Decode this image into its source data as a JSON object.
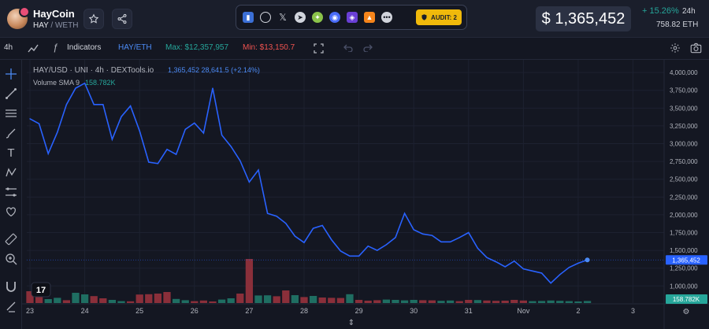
{
  "header": {
    "token_name": "HayCoin",
    "token_symbol": "HAY",
    "pair_quote": "/ WETH",
    "audit_label": "AUDIT: 2",
    "price": "$ 1,365,452",
    "change": "+ 15.26%",
    "change_period": "24h",
    "eth_price": "758.82 ETH",
    "positive_color": "#26a69a",
    "negative_color": "#ef5350",
    "line_color": "#2962ff"
  },
  "toolbar": {
    "timeframe": "4h",
    "indicators_label": "Indicators",
    "pair_label": "HAY/ETH",
    "max_label": "Max: $12,357,957",
    "min_label": "Min: $13,150.7"
  },
  "chart_data": {
    "type": "line",
    "legend_title": "HAY/USD · UNI · 4h · DEXTools.io",
    "legend_value": "1,365,452  28,641.5 (+2.14%)",
    "volume_label": "Volume SMA 9",
    "volume_value": "158.782K",
    "last_price_label": "1,365,452",
    "last_volume_label": "158.782K",
    "x_ticks": [
      {
        "label": "23",
        "t": 0
      },
      {
        "label": "24",
        "t": 6
      },
      {
        "label": "25",
        "t": 12
      },
      {
        "label": "26",
        "t": 18
      },
      {
        "label": "27",
        "t": 24
      },
      {
        "label": "28",
        "t": 30
      },
      {
        "label": "29",
        "t": 36
      },
      {
        "label": "30",
        "t": 42
      },
      {
        "label": "31",
        "t": 48
      },
      {
        "label": "Nov",
        "t": 54
      },
      {
        "label": "2",
        "t": 60
      },
      {
        "label": "3",
        "t": 66
      }
    ],
    "y_ticks": [
      4000000,
      3750000,
      3500000,
      3250000,
      3000000,
      2750000,
      2500000,
      2250000,
      2000000,
      1750000,
      1500000,
      1250000,
      1000000
    ],
    "y_tick_labels": [
      "4,000,000",
      "3,750,000",
      "3,500,000",
      "3,250,000",
      "3,000,000",
      "2,750,000",
      "2,500,000",
      "2,250,000",
      "2,000,000",
      "1,750,000",
      "1,500,000",
      "1,250,000",
      "1,000,000"
    ],
    "ylim": [
      760000,
      4090000
    ],
    "series": [
      {
        "values": [
          3350000,
          3280000,
          2860000,
          3160000,
          3550000,
          3780000,
          3850000,
          3550000,
          3550000,
          3060000,
          3380000,
          3530000,
          3180000,
          2740000,
          2720000,
          2920000,
          2850000,
          3200000,
          3290000,
          3150000,
          3780000,
          3120000,
          2960000,
          2760000,
          2460000,
          2630000,
          2020000,
          1980000,
          1880000,
          1700000,
          1610000,
          1810000,
          1850000,
          1650000,
          1490000,
          1420000,
          1420000,
          1560000,
          1500000,
          1580000,
          1680000,
          2020000,
          1790000,
          1730000,
          1710000,
          1620000,
          1620000,
          1680000,
          1750000,
          1530000,
          1400000,
          1340000,
          1270000,
          1350000,
          1240000,
          1210000,
          1180000,
          1040000,
          1160000,
          1260000,
          1320000,
          1365452
        ]
      }
    ],
    "volume": {
      "ymax": 2900000,
      "up": [
        false,
        false,
        true,
        true,
        false,
        true,
        true,
        false,
        false,
        true,
        true,
        false,
        false,
        false,
        false,
        false,
        true,
        true,
        false,
        false,
        false,
        true,
        true,
        false,
        false,
        true,
        true,
        false,
        false,
        true,
        false,
        true,
        false,
        false,
        false,
        true,
        false,
        false,
        false,
        true,
        true,
        true,
        true,
        false,
        false,
        true,
        true,
        false,
        false,
        true,
        false,
        false,
        false,
        false,
        false,
        true,
        true,
        true,
        true,
        true,
        true,
        true
      ],
      "values": [
        750000,
        420000,
        250000,
        330000,
        180000,
        650000,
        550000,
        440000,
        300000,
        200000,
        120000,
        110000,
        540000,
        560000,
        600000,
        700000,
        260000,
        180000,
        120000,
        160000,
        100000,
        220000,
        300000,
        600000,
        2800000,
        480000,
        490000,
        430000,
        800000,
        500000,
        380000,
        450000,
        350000,
        330000,
        320000,
        560000,
        200000,
        150000,
        180000,
        220000,
        200000,
        170000,
        200000,
        180000,
        170000,
        140000,
        160000,
        120000,
        200000,
        190000,
        160000,
        140000,
        150000,
        200000,
        160000,
        120000,
        130000,
        160000,
        140000,
        120000,
        100000,
        130000
      ]
    }
  }
}
